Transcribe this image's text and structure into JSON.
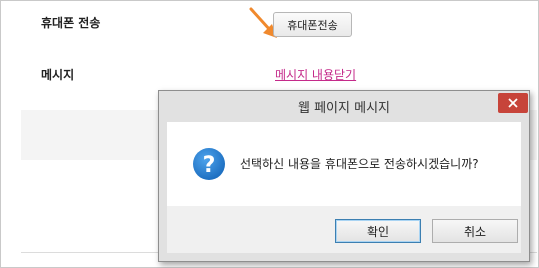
{
  "form": {
    "phone_label": "휴대폰 전송",
    "phone_button": "휴대폰전송",
    "message_label": "메시지",
    "message_link": "메시지 내용닫기"
  },
  "dialog": {
    "title": "웹 페이지 메시지",
    "question": "선택하신 내용을 휴대폰으로 전송하시겠습니까?",
    "ok_label": "확인",
    "cancel_label": "취소",
    "icon": "question-icon",
    "close_icon": "close-icon"
  },
  "colors": {
    "arrow": "#f0892d",
    "link": "#c42a8a",
    "close": "#c7443a",
    "question_icon": "#1d6fc1"
  }
}
